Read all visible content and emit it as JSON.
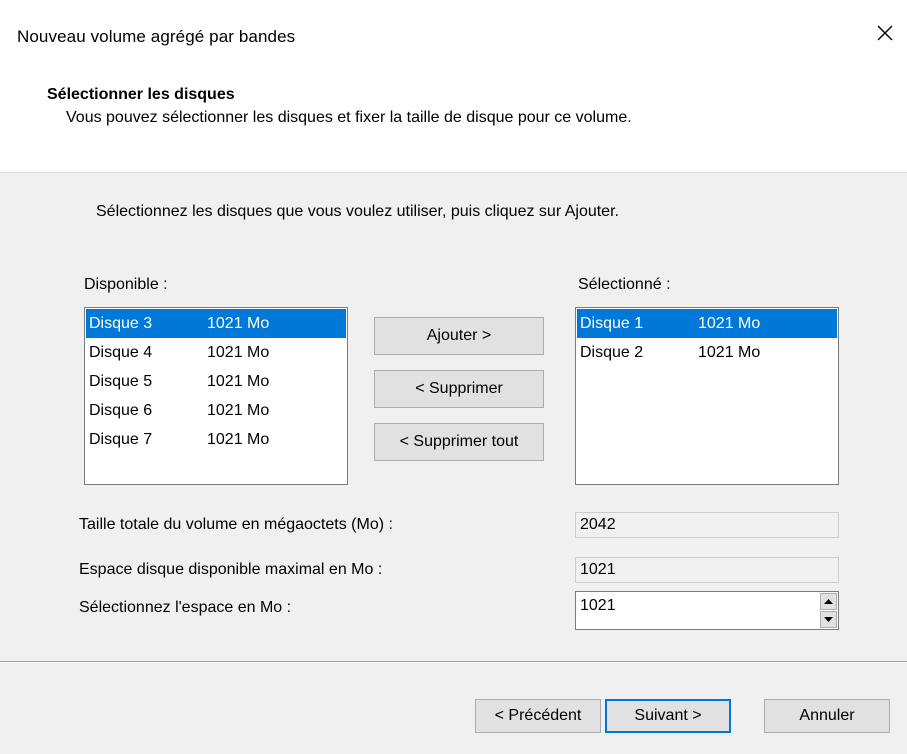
{
  "window": {
    "title": "Nouveau volume agrégé par bandes"
  },
  "header": {
    "title": "Sélectionner les disques",
    "subtitle": "Vous pouvez sélectionner les disques et fixer la taille de disque pour ce volume."
  },
  "instructions": "Sélectionnez les disques que vous voulez utiliser, puis cliquez sur Ajouter.",
  "available": {
    "label": "Disponible :",
    "items": [
      {
        "name": "Disque 3",
        "size": "1021 Mo",
        "selected": true
      },
      {
        "name": "Disque 4",
        "size": "1021 Mo",
        "selected": false
      },
      {
        "name": "Disque 5",
        "size": "1021 Mo",
        "selected": false
      },
      {
        "name": "Disque 6",
        "size": "1021 Mo",
        "selected": false
      },
      {
        "name": "Disque 7",
        "size": "1021 Mo",
        "selected": false
      }
    ]
  },
  "selected": {
    "label": "Sélectionné :",
    "items": [
      {
        "name": "Disque 1",
        "size": "1021 Mo",
        "selected": true
      },
      {
        "name": "Disque 2",
        "size": "1021 Mo",
        "selected": false
      }
    ]
  },
  "actions": {
    "add": "Ajouter >",
    "remove": "< Supprimer",
    "remove_all": "< Supprimer tout"
  },
  "fields": {
    "total_size_label": "Taille totale du volume en mégaoctets (Mo) :",
    "total_size_value": "2042",
    "max_space_label": "Espace disque disponible maximal en Mo :",
    "max_space_value": "1021",
    "select_space_label": "Sélectionnez l'espace en Mo :",
    "select_space_value": "1021"
  },
  "footer": {
    "back": "< Précédent",
    "next": "Suivant >",
    "cancel": "Annuler"
  },
  "colors": {
    "selection": "#0078d7",
    "body_bg": "#f0f0f0"
  }
}
